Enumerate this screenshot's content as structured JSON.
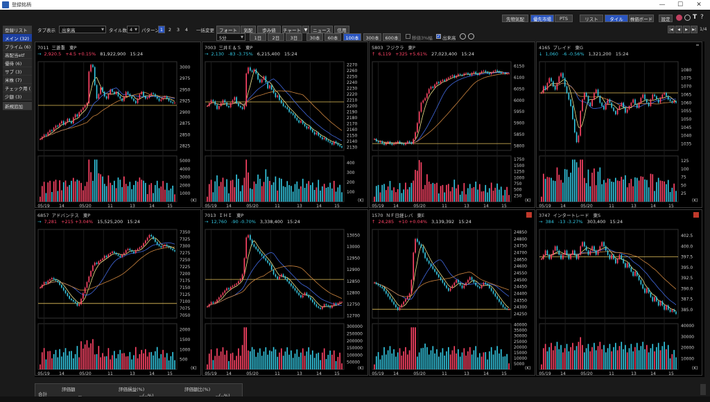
{
  "window": {
    "title": "登録銘柄",
    "min": "—",
    "max": "☐",
    "close": "✕"
  },
  "toolbar_top_right": {
    "buttons": [
      "先物気配",
      "優先市場",
      "PTS",
      "リスト",
      "タイル",
      "株価ボード",
      "設定"
    ],
    "active": [
      "優先市場",
      "タイル"
    ]
  },
  "toolbar": {
    "tab_display_label": "タブ表示",
    "tab_display_value": "出来高",
    "tile_count_label": "タイル数",
    "tile_count_value": "4",
    "pattern_label": "パターン",
    "patterns": [
      "1",
      "2",
      "3",
      "4"
    ],
    "bulk_change_label": "一括変更",
    "bulk_buttons": [
      "フォート",
      "気配",
      "歩み値",
      "チャート",
      "ニュース",
      "信用"
    ],
    "interval_value": "5分",
    "period_buttons": [
      "1日",
      "2日",
      "3日",
      "30本",
      "60本",
      "100本",
      "300本",
      "600本"
    ],
    "period_active": "100本",
    "check_ma": "移値3%幅",
    "check_vol": "出来高",
    "pager": "1/4"
  },
  "sidebar": {
    "items": [
      "登録リスト",
      "メイン (32)",
      "プライム (6)",
      "高配当etf",
      "優待 (6)",
      "サブ (3)",
      "米株 (7)",
      "チェック用 (",
      "少額 (3)",
      "新規追加"
    ],
    "active_index": 1
  },
  "panels": [
    {
      "code": "7011",
      "name": "三菱重",
      "market": "東P",
      "dir": "→",
      "price": "2,920.5",
      "chg": "+4.5 +0.15%",
      "chg_dir": "up",
      "price_dir": "up",
      "volume": "81,922,900",
      "time": "15:24",
      "yticks": [
        "3000",
        "2975",
        "2950",
        "2925",
        "2900",
        "2875",
        "2850",
        "2825"
      ],
      "vticks": [
        "5000",
        "4000",
        "3000",
        "2000",
        "1000"
      ],
      "xticks": [
        "05/19",
        "14",
        "05/20",
        "11",
        "13",
        "14",
        "15"
      ],
      "unit": "(K)",
      "ylim": [
        2815,
        3012
      ],
      "vmax": 5600,
      "close": [
        2840,
        2845,
        2850,
        2848,
        2855,
        2860,
        2858,
        2865,
        2870,
        2868,
        2875,
        2880,
        2872,
        2878,
        2885,
        2880,
        2875,
        2888,
        2895,
        2890,
        2900,
        2905,
        2910,
        2915,
        2920,
        2990,
        3005,
        3000,
        2960,
        2930,
        2940,
        2955,
        2945,
        2935,
        2930,
        2940,
        2950,
        2945,
        2940,
        2945,
        2935,
        2930,
        2925,
        2935,
        2945,
        2940,
        2935,
        2930,
        2925,
        2920,
        2930,
        2940,
        2945,
        2935,
        2930,
        2932,
        2938,
        2942,
        2940,
        2935,
        2930,
        2925,
        2928,
        2932,
        2935,
        2930,
        2925,
        2922,
        2920,
        2921
      ],
      "hline": 2915,
      "badge": false
    },
    {
      "code": "7003",
      "name": "三井Ｅ＆Ｓ",
      "market": "東P",
      "dir": "→",
      "price": "2,130",
      "chg": "-83 -3.75%",
      "chg_dir": "down",
      "price_dir": "down",
      "volume": "6,215,400",
      "time": "15:24",
      "yticks": [
        "2270",
        "2260",
        "2250",
        "2240",
        "2230",
        "2220",
        "2210",
        "2200",
        "2190",
        "2180",
        "2170",
        "2160",
        "2150",
        "2140",
        "2130"
      ],
      "vticks": [
        "400",
        "300",
        "200",
        "100"
      ],
      "xticks": [
        "05/19",
        "14",
        "05/20",
        "11",
        "13",
        "14",
        "15"
      ],
      "unit": "(K)",
      "ylim": [
        2125,
        2275
      ],
      "vmax": 470,
      "close": [
        2200,
        2205,
        2210,
        2208,
        2202,
        2195,
        2200,
        2205,
        2210,
        2206,
        2200,
        2198,
        2205,
        2210,
        2215,
        2205,
        2200,
        2198,
        2195,
        2200,
        2255,
        2265,
        2260,
        2258,
        2262,
        2255,
        2245,
        2240,
        2245,
        2250,
        2240,
        2230,
        2235,
        2228,
        2222,
        2215,
        2218,
        2210,
        2205,
        2200,
        2198,
        2195,
        2190,
        2188,
        2185,
        2180,
        2176,
        2172,
        2175,
        2170,
        2166,
        2162,
        2165,
        2160,
        2156,
        2152,
        2155,
        2150,
        2147,
        2144,
        2146,
        2142,
        2140,
        2138,
        2135,
        2140,
        2137,
        2134,
        2132,
        2130
      ],
      "hline": 2207,
      "badge": false
    },
    {
      "code": "5803",
      "name": "フジクラ",
      "market": "東P",
      "dir": "↑",
      "price": "6,119",
      "chg": "+325 +5.61%",
      "chg_dir": "up",
      "price_dir": "up",
      "volume": "27,023,400",
      "time": "15:24",
      "yticks": [
        "6150",
        "6100",
        "6050",
        "6000",
        "5950",
        "5900",
        "5850",
        "5800"
      ],
      "vticks": [
        "1750",
        "1500",
        "1250",
        "1000",
        "750",
        "500",
        "250"
      ],
      "xticks": [
        "05/19",
        "14",
        "05/20",
        "11",
        "13",
        "14",
        "15"
      ],
      "unit": "(K)",
      "ylim": [
        5780,
        6170
      ],
      "vmax": 1900,
      "close": [
        5830,
        5820,
        5815,
        5820,
        5810,
        5805,
        5812,
        5818,
        5810,
        5805,
        5808,
        5815,
        5820,
        5812,
        5808,
        5805,
        5812,
        5820,
        5815,
        5810,
        5830,
        5860,
        5900,
        5950,
        5990,
        6000,
        6010,
        6030,
        6050,
        6060,
        6055,
        6070,
        6080,
        6075,
        6085,
        6090,
        6085,
        6095,
        6100,
        6105,
        6110,
        6100,
        6108,
        6115,
        6112,
        6110,
        6118,
        6120,
        6115,
        6110,
        6120,
        6125,
        6118,
        6112,
        6120,
        6128,
        6130,
        6125,
        6120,
        6115,
        6122,
        6128,
        6132,
        6128,
        6122,
        6118,
        6120,
        6116,
        6118,
        6119
      ],
      "hline": 5810,
      "badge": false
    },
    {
      "code": "4165",
      "name": "プレイド",
      "market": "東G",
      "dir": "↓",
      "price": "1,060",
      "chg": "-6 -0.56%",
      "chg_dir": "down",
      "price_dir": "down",
      "volume": "1,321,200",
      "time": "15:24",
      "yticks": [
        "1080",
        "1075",
        "1070",
        "1065",
        "1060",
        "1055",
        "1050",
        "1045",
        "1040",
        "1035"
      ],
      "vticks": [
        "125",
        "100",
        "75",
        "50",
        "25"
      ],
      "xticks": [
        "05/19",
        "14",
        "05/20",
        "11",
        "13",
        "14",
        "15"
      ],
      "unit": "(K)",
      "ylim": [
        1031,
        1085
      ],
      "vmax": 140,
      "close": [
        1066,
        1070,
        1068,
        1072,
        1075,
        1073,
        1070,
        1068,
        1072,
        1076,
        1078,
        1075,
        1070,
        1066,
        1062,
        1058,
        1050,
        1042,
        1036,
        1040,
        1055,
        1062,
        1066,
        1064,
        1060,
        1058,
        1062,
        1066,
        1068,
        1064,
        1060,
        1058,
        1056,
        1059,
        1062,
        1060,
        1057,
        1055,
        1053,
        1056,
        1058,
        1060,
        1057,
        1054,
        1056,
        1058,
        1060,
        1062,
        1059,
        1057,
        1060,
        1063,
        1065,
        1062,
        1060,
        1058,
        1062,
        1065,
        1064,
        1062,
        1060,
        1063,
        1065,
        1066,
        1064,
        1062,
        1061,
        1060,
        1061,
        1060
      ],
      "hline": 1066,
      "badge": true
    },
    {
      "code": "6857",
      "name": "アドバンテス",
      "market": "東P",
      "dir": "→",
      "price": "7,281",
      "chg": "+215 +3.04%",
      "chg_dir": "up",
      "price_dir": "up",
      "volume": "15,525,200",
      "time": "15:24",
      "yticks": [
        "7350",
        "7325",
        "7300",
        "7275",
        "7250",
        "7225",
        "7200",
        "7175",
        "7150",
        "7125",
        "7100",
        "7075",
        "7050"
      ],
      "vticks": [
        "2000",
        "1500",
        "1000",
        "500"
      ],
      "xticks": [
        "05/19",
        "14",
        "05/20",
        "11",
        "13",
        "14",
        "15"
      ],
      "unit": "(K)",
      "ylim": [
        7040,
        7360
      ],
      "vmax": 2300,
      "close": [
        7150,
        7160,
        7170,
        7165,
        7175,
        7180,
        7185,
        7180,
        7175,
        7170,
        7160,
        7150,
        7140,
        7130,
        7120,
        7110,
        7105,
        7100,
        7095,
        7085,
        7090,
        7110,
        7130,
        7150,
        7170,
        7190,
        7210,
        7230,
        7240,
        7235,
        7245,
        7250,
        7255,
        7265,
        7260,
        7270,
        7275,
        7280,
        7275,
        7270,
        7265,
        7260,
        7270,
        7275,
        7285,
        7290,
        7285,
        7280,
        7275,
        7285,
        7290,
        7295,
        7300,
        7310,
        7320,
        7330,
        7340,
        7335,
        7325,
        7315,
        7305,
        7300,
        7295,
        7300,
        7305,
        7300,
        7295,
        7290,
        7285,
        7281
      ],
      "hline": 7093,
      "badge": false
    },
    {
      "code": "7013",
      "name": "ＩＨＩ",
      "market": "東P",
      "dir": "→",
      "price": "12,760",
      "chg": "-90 -0.70%",
      "chg_dir": "down",
      "price_dir": "down",
      "volume": "3,338,400",
      "time": "15:24",
      "yticks": [
        "13050",
        "13000",
        "12950",
        "12900",
        "12850",
        "12800",
        "12750",
        "12700"
      ],
      "vticks": [
        "300000",
        "250000",
        "200000",
        "150000",
        "100000",
        "50000"
      ],
      "xticks": [
        "05/19",
        "14",
        "05/20",
        "11",
        "13",
        "14",
        "15"
      ],
      "unit": "(K)",
      "ylim": [
        12690,
        13075
      ],
      "vmax": 320000,
      "close": [
        12740,
        12750,
        12760,
        12755,
        12760,
        12770,
        12780,
        12790,
        12800,
        12810,
        12820,
        12815,
        12825,
        12830,
        12835,
        12840,
        12850,
        12860,
        12880,
        12950,
        13040,
        13050,
        13030,
        13010,
        13000,
        12990,
        12980,
        12970,
        12960,
        12950,
        12940,
        12930,
        12920,
        12900,
        12880,
        12870,
        12860,
        12870,
        12880,
        12870,
        12860,
        12850,
        12840,
        12830,
        12820,
        12810,
        12800,
        12790,
        12780,
        12790,
        12800,
        12790,
        12780,
        12770,
        12760,
        12750,
        12740,
        12735,
        12730,
        12740,
        12750,
        12745,
        12740,
        12735,
        12745,
        12755,
        12750,
        12755,
        12760,
        12760
      ],
      "hline": 12858,
      "badge": false
    },
    {
      "code": "1570",
      "name": "ＮＦ日経レバ",
      "market": "東E",
      "dir": "↑",
      "price": "24,285",
      "chg": "+10 +0.04%",
      "chg_dir": "up",
      "price_dir": "up",
      "volume": "3,139,392",
      "time": "15:24",
      "yticks": [
        "24850",
        "24800",
        "24750",
        "24700",
        "24650",
        "24600",
        "24550",
        "24500",
        "24450",
        "24400",
        "24350",
        "24300",
        "24250"
      ],
      "vticks": [
        "40000",
        "35000",
        "30000",
        "25000",
        "20000",
        "15000",
        "10000",
        "5000"
      ],
      "xticks": [
        "05/19",
        "14",
        "05/20",
        "11",
        "13",
        "14",
        "15"
      ],
      "unit": "(K)",
      "ylim": [
        24220,
        24870
      ],
      "vmax": 41000,
      "close": [
        24480,
        24470,
        24460,
        24450,
        24440,
        24420,
        24400,
        24380,
        24360,
        24340,
        24320,
        24300,
        24280,
        24300,
        24320,
        24340,
        24360,
        24380,
        24400,
        24500,
        24700,
        24800,
        24780,
        24760,
        24740,
        24700,
        24660,
        24640,
        24620,
        24600,
        24580,
        24560,
        24540,
        24520,
        24500,
        24480,
        24460,
        24440,
        24420,
        24440,
        24460,
        24480,
        24500,
        24480,
        24460,
        24440,
        24460,
        24480,
        24500,
        24520,
        24500,
        24480,
        24460,
        24450,
        24440,
        24460,
        24480,
        24470,
        24460,
        24440,
        24420,
        24400,
        24380,
        24360,
        24340,
        24320,
        24300,
        24290,
        24285,
        24285
      ],
      "hline": 24285,
      "badge": true
    },
    {
      "code": "3747",
      "name": "インタートレード",
      "market": "東S",
      "dir": "→",
      "price": "384",
      "chg": "-13 -3.27%",
      "chg_dir": "down",
      "price_dir": "down",
      "volume": "303,400",
      "time": "15:24",
      "yticks": [
        "402.5",
        "400.0",
        "397.5",
        "395.0",
        "392.5",
        "390.0",
        "387.5",
        "385.0"
      ],
      "vticks": [
        "40000",
        "30000",
        "20000",
        "10000"
      ],
      "xticks": [
        "05/19",
        "14",
        "05/20",
        "11",
        "13",
        "14",
        "15"
      ],
      "unit": "(K)",
      "ylim": [
        383,
        404
      ],
      "vmax": 42000,
      "close": [
        397,
        398,
        399,
        398,
        397,
        398,
        399,
        400,
        399,
        398,
        397,
        398,
        399,
        398,
        397,
        398,
        399,
        398,
        397,
        398,
        400,
        401,
        400,
        399,
        398,
        399,
        400,
        399,
        398,
        399,
        400,
        401,
        400,
        399,
        398,
        397,
        398,
        397,
        396,
        397,
        398,
        397,
        396,
        395,
        396,
        395,
        394,
        393,
        394,
        393,
        392,
        391,
        390,
        389,
        390,
        389,
        388,
        387,
        388,
        387,
        386,
        387,
        386,
        385,
        386,
        385,
        384.5,
        385,
        384.5,
        384
      ],
      "hline": 397.5,
      "badge": true
    }
  ],
  "bottom_table": {
    "row_label": "合計",
    "headers": [
      "評価額",
      "評価損益(%)",
      "評価額比(%)"
    ],
    "values": [
      "--",
      "--(--%)",
      "--(--%)"
    ]
  },
  "colors": {
    "up": "#ff4466",
    "down": "#33c6e0",
    "ma_short": "#f0e68c",
    "ma_mid": "#4169e1",
    "ma_long": "#cd853f",
    "hline": "#e6c35c"
  }
}
